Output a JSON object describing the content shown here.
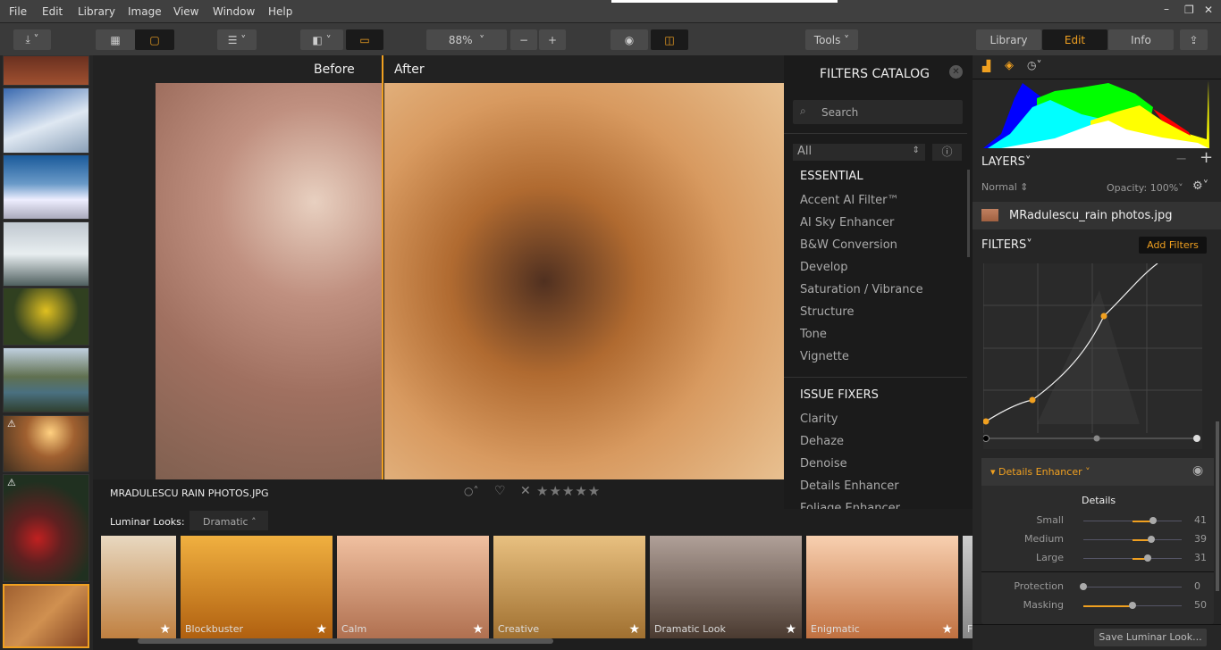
{
  "menu": [
    "File",
    "Edit",
    "Library",
    "Image",
    "View",
    "Window",
    "Help"
  ],
  "toolbar": {
    "zoom": "88%",
    "tools": "Tools",
    "modes": [
      "Library",
      "Edit",
      "Info"
    ],
    "active_mode": "Edit",
    "accent": "#f0a020"
  },
  "canvas": {
    "before": "Before",
    "after": "After",
    "split": 0.33
  },
  "file": {
    "name": "MRADULESCU  RAIN PHOTOS.JPG",
    "rating": 0
  },
  "looks": {
    "label": "Luminar Looks:",
    "selected": "Dramatic",
    "items": [
      "",
      "Blockbuster",
      "Calm",
      "Creative",
      "Dramatic Look",
      "Enigmatic",
      "F"
    ]
  },
  "catalog": {
    "title": "FILTERS CATALOG",
    "search_placeholder": "Search",
    "category": "All",
    "sections": [
      {
        "title": "ESSENTIAL",
        "items": [
          "Accent AI Filter™",
          "AI Sky Enhancer",
          "B&W Conversion",
          "Develop",
          "Saturation / Vibrance",
          "Structure",
          "Tone",
          "Vignette"
        ]
      },
      {
        "title": "ISSUE FIXERS",
        "items": [
          "Clarity",
          "Dehaze",
          "Denoise",
          "Details Enhancer",
          "Foliage Enhancer"
        ]
      }
    ]
  },
  "layers": {
    "title": "LAYERS",
    "blend": "Normal",
    "opacity": "Opacity: 100%",
    "layer_name": "MRadulescu_rain photos.jpg"
  },
  "filters": {
    "title": "FILTERS",
    "add": "Add Filters",
    "details": {
      "name": "Details Enhancer",
      "group": "Details",
      "sliders": [
        {
          "label": "Small",
          "value": 41
        },
        {
          "label": "Medium",
          "value": 39
        },
        {
          "label": "Large",
          "value": 31
        }
      ],
      "extra": [
        {
          "label": "Protection",
          "value": 0
        },
        {
          "label": "Masking",
          "value": 50
        }
      ]
    }
  },
  "save_look": "Save Luminar Look..."
}
